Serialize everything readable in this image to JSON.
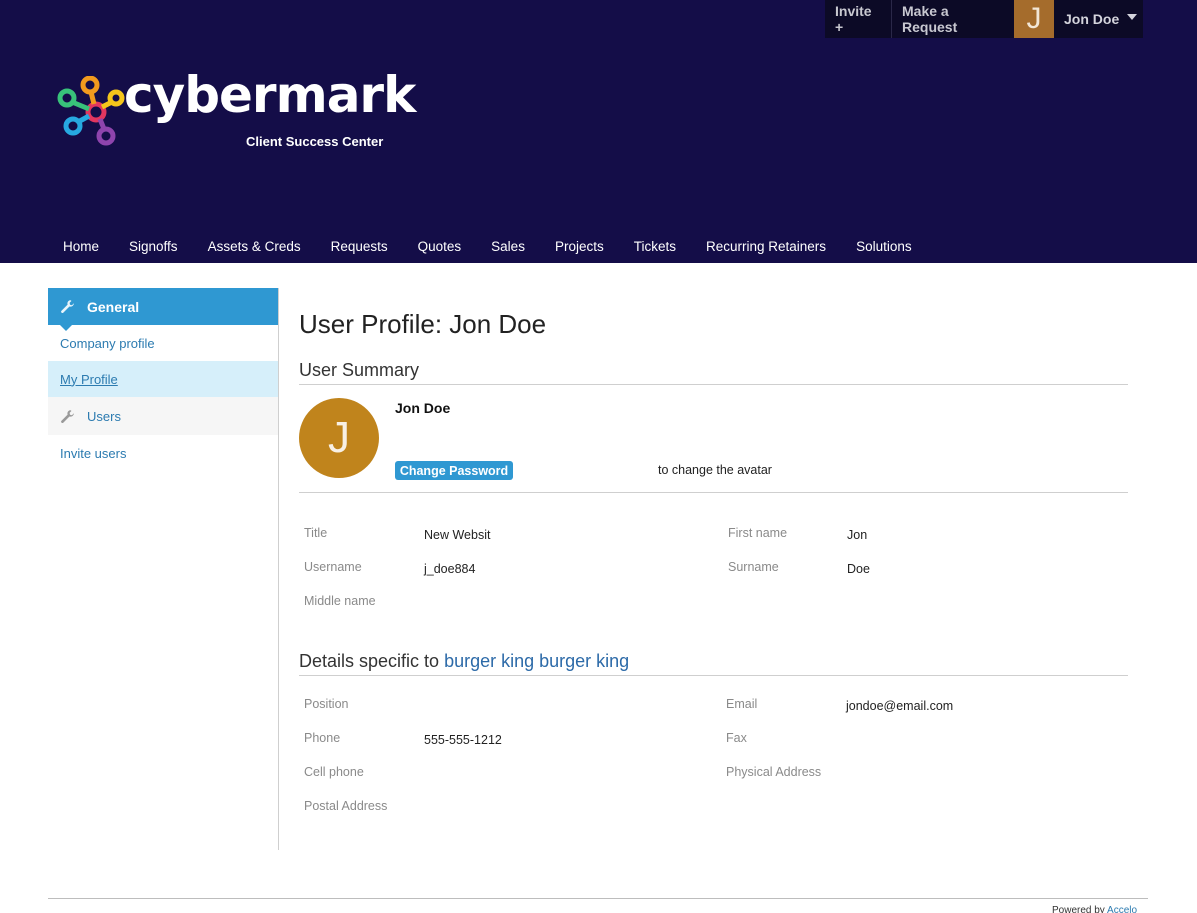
{
  "topbar": {
    "invite_label": "Invite +",
    "request_label": "Make a Request",
    "avatar_letter": "J",
    "user_name": "Jon Doe"
  },
  "logo": {
    "word": "cybermark",
    "subtitle": "Client Success Center"
  },
  "nav": {
    "items": [
      "Home",
      "Signoffs",
      "Assets & Creds",
      "Requests",
      "Quotes",
      "Sales",
      "Projects",
      "Tickets",
      "Recurring Retainers",
      "Solutions"
    ]
  },
  "sidebar": {
    "header": "General",
    "items": [
      {
        "label": "Company profile"
      },
      {
        "label": "My Profile"
      },
      {
        "label": "Users"
      },
      {
        "label": "Invite users"
      }
    ]
  },
  "profile": {
    "page_title": "User Profile: Jon Doe",
    "summary_title": "User Summary",
    "avatar_letter": "J",
    "name": "Jon Doe",
    "change_password": "Change Password",
    "avatar_hint": "to change the avatar",
    "fields": {
      "title_label": "Title",
      "title_value": "New Websit",
      "username_label": "Username",
      "username_value": "j_doe884",
      "middle_label": "Middle name",
      "first_label": "First name",
      "first_value": "Jon",
      "surname_label": "Surname",
      "surname_value": "Doe"
    }
  },
  "details": {
    "title_prefix": "Details specific to",
    "company": "burger king burger king",
    "fields": {
      "position_label": "Position",
      "phone_label": "Phone",
      "phone_value": "555-555-1212",
      "cell_label": "Cell phone",
      "postal_label": "Postal Address",
      "email_label": "Email",
      "email_value": "jondoe@email.com",
      "fax_label": "Fax",
      "physical_label": "Physical Address"
    }
  },
  "footer": {
    "powered_by": "Powered by",
    "brand": "Accelo"
  },
  "colors": {
    "header_bg": "#140d48",
    "accent_blue": "#2f98d2",
    "avatar_orange": "#c0841c",
    "link_blue": "#2c7bb0"
  }
}
